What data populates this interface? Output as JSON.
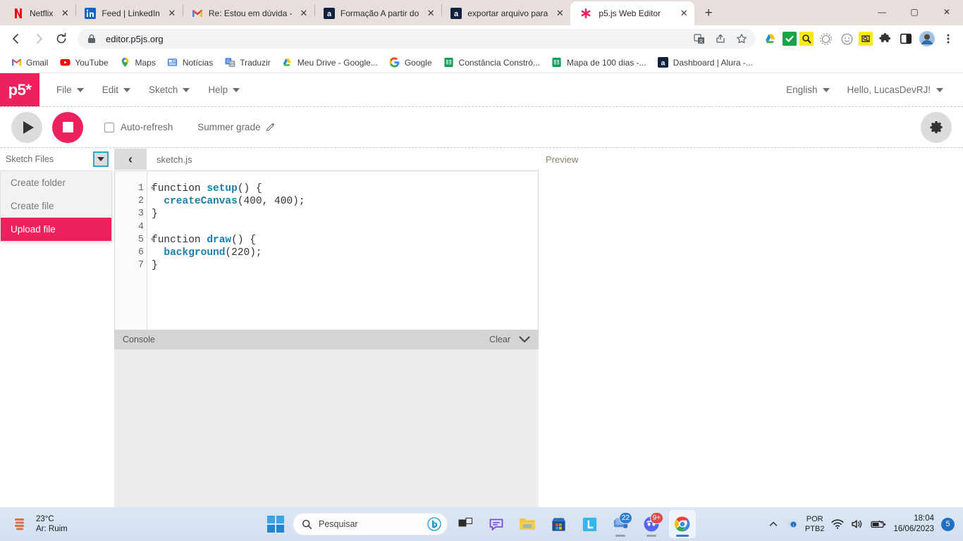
{
  "browser": {
    "tabs": [
      {
        "title": "Netflix",
        "icon": "netflix-icon",
        "active": false
      },
      {
        "title": "Feed | LinkedIn",
        "icon": "linkedin-icon",
        "active": false
      },
      {
        "title": "Re: Estou em dúvida -",
        "icon": "gmail-icon",
        "active": false
      },
      {
        "title": "Formação A partir do",
        "icon": "alura-icon",
        "active": false
      },
      {
        "title": "exportar arquivo para",
        "icon": "alura-icon",
        "active": false
      },
      {
        "title": "p5.js Web Editor",
        "icon": "p5-asterisk-icon",
        "active": true
      }
    ],
    "new_tab_label": "+",
    "tab_close_label": "✕",
    "window_controls": {
      "minimize": "—",
      "maximize": "▢",
      "close": "✕"
    },
    "toolbar": {
      "back_label": "←",
      "forward_label": "→",
      "reload_label": "⟳",
      "url": "editor.p5js.org",
      "lock_icon": "lock-icon",
      "translate_icon": "translate-icon",
      "share_icon": "share-icon",
      "bookmark_icon": "star-icon",
      "extensions": [
        "google-drive-extension",
        "checkmark-extension",
        "magnifier-yellow-extension",
        "circle-dotted-extension",
        "emoji-extension",
        "screenshot-yellow-extension",
        "puzzle-extensions-icon",
        "sidepanel-icon"
      ],
      "profile_icon": "avatar-icon",
      "menu_icon": "kebab-menu-icon"
    },
    "bookmarks": [
      {
        "label": "Gmail",
        "icon": "gmail-icon"
      },
      {
        "label": "YouTube",
        "icon": "youtube-icon"
      },
      {
        "label": "Maps",
        "icon": "maps-pin-icon"
      },
      {
        "label": "Notícias",
        "icon": "news-icon"
      },
      {
        "label": "Traduzir",
        "icon": "translate-icon"
      },
      {
        "label": "Meu Drive - Google...",
        "icon": "drive-icon"
      },
      {
        "label": "Google",
        "icon": "google-g-icon"
      },
      {
        "label": "Constância Constró...",
        "icon": "sheets-icon"
      },
      {
        "label": "Mapa de 100 dias -...",
        "icon": "sheets-icon"
      },
      {
        "label": "Dashboard | Alura -...",
        "icon": "alura-icon"
      }
    ]
  },
  "p5": {
    "logo": "p5*",
    "menu": [
      "File",
      "Edit",
      "Sketch",
      "Help"
    ],
    "language": "English",
    "greeting": "Hello, LucasDevRJ!",
    "toolbar": {
      "play_label": "play-button",
      "stop_label": "stop-button",
      "auto_refresh_label": "Auto-refresh",
      "auto_refresh_checked": false,
      "sketch_name": "Summer grade",
      "edit_pencil": "✎",
      "settings_label": "settings-gear"
    },
    "sidebar": {
      "title": "Sketch Files",
      "dropdown_caret": "▼",
      "menu_items": [
        {
          "label": "Create folder",
          "highlighted": false
        },
        {
          "label": "Create file",
          "highlighted": false
        },
        {
          "label": "Upload file",
          "highlighted": true
        }
      ]
    },
    "editor": {
      "collapse_label": "‹",
      "file_tab": "sketch.js",
      "line_numbers": [
        "1",
        "2",
        "3",
        "4",
        "5",
        "6",
        "7"
      ],
      "fold_lines": [
        1,
        5
      ],
      "code_lines": [
        [
          {
            "t": "function ",
            "c": "kw"
          },
          {
            "t": "setup",
            "c": "fn"
          },
          {
            "t": "() {",
            "c": "kw"
          }
        ],
        [
          {
            "t": "  ",
            "c": "kw"
          },
          {
            "t": "createCanvas",
            "c": "fn"
          },
          {
            "t": "(400, 400);",
            "c": "kw"
          }
        ],
        [
          {
            "t": "}",
            "c": "kw"
          }
        ],
        [
          {
            "t": "",
            "c": "kw"
          }
        ],
        [
          {
            "t": "function ",
            "c": "kw"
          },
          {
            "t": "draw",
            "c": "fn"
          },
          {
            "t": "() {",
            "c": "kw"
          }
        ],
        [
          {
            "t": "  ",
            "c": "kw"
          },
          {
            "t": "background",
            "c": "fn"
          },
          {
            "t": "(220);",
            "c": "kw"
          }
        ],
        [
          {
            "t": "}",
            "c": "kw"
          }
        ]
      ]
    },
    "console": {
      "title": "Console",
      "clear_label": "Clear",
      "chevron": "⌄"
    },
    "preview": {
      "title": "Preview"
    },
    "accent_color": "#ed225d"
  },
  "taskbar": {
    "weather": {
      "temp": "23°C",
      "air": "Ar: Ruim",
      "icon": "weather-dust-icon"
    },
    "start_label": "start-button",
    "search_placeholder": "Pesquisar",
    "search_icon": "search-icon",
    "copilot_icon": "bing-chat-icon",
    "apps": [
      {
        "name": "task-view",
        "badge": null,
        "running": false
      },
      {
        "name": "teams-chat",
        "badge": null,
        "running": false
      },
      {
        "name": "file-explorer",
        "badge": null,
        "running": false
      },
      {
        "name": "microsoft-store",
        "badge": null,
        "running": false
      },
      {
        "name": "lightshot-app",
        "badge": null,
        "running": false
      },
      {
        "name": "teams-app",
        "badge": "22",
        "running": true
      },
      {
        "name": "discord-app",
        "badge": "9+",
        "running": true
      },
      {
        "name": "google-chrome",
        "badge": null,
        "running": true,
        "active": true
      }
    ],
    "tray": {
      "overflow_icon": "chevron-up-icon",
      "info_icon": "info-badge-icon",
      "language": "POR",
      "keyboard": "PTB2",
      "wifi_icon": "wifi-icon",
      "volume_icon": "volume-icon",
      "battery_icon": "battery-icon",
      "time": "18:04",
      "date": "16/06/2023",
      "notification_count": "5"
    }
  }
}
